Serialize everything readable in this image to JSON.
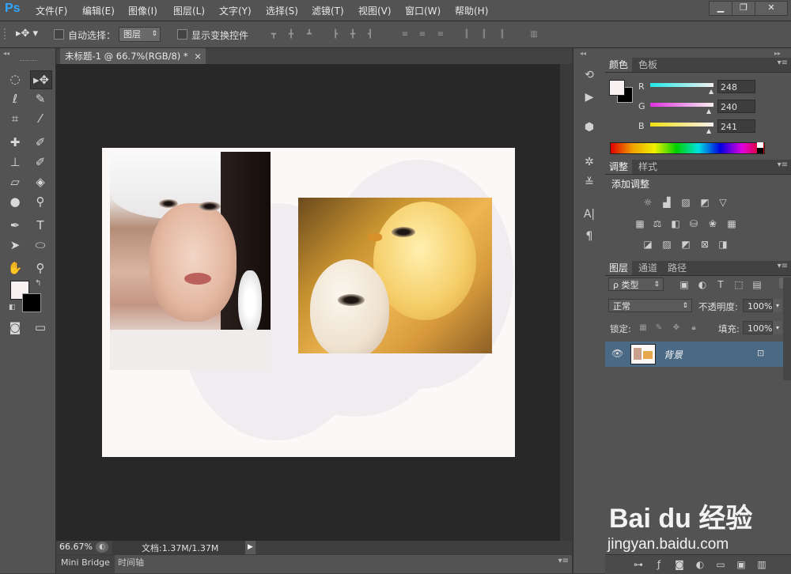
{
  "app": {
    "logo": "Ps"
  },
  "menu": [
    "文件(F)",
    "编辑(E)",
    "图像(I)",
    "图层(L)",
    "文字(Y)",
    "选择(S)",
    "滤镜(T)",
    "视图(V)",
    "窗口(W)",
    "帮助(H)"
  ],
  "window_controls": {
    "minimize": "▁",
    "restore": "❐",
    "close": "✕"
  },
  "options": {
    "auto_select_label": "自动选择：",
    "auto_select_value": "图层",
    "show_transform_label": "显示变换控件"
  },
  "document": {
    "tab_title": "未标题-1 @ 66.7%(RGB/8) *",
    "close": "×"
  },
  "status": {
    "zoom": "66.67%",
    "doc_info": "文档:1.37M/1.37M"
  },
  "bottom_tabs": [
    "Mini Bridge",
    "时间轴"
  ],
  "color_panel": {
    "tabs": [
      "颜色",
      "色板"
    ],
    "channels": [
      {
        "label": "R",
        "value": "248",
        "color": "#26e0e8"
      },
      {
        "label": "G",
        "value": "240",
        "color": "#e040d8"
      },
      {
        "label": "B",
        "value": "241",
        "color": "#f0e020"
      }
    ],
    "foreground": "#f8f0f1",
    "background": "#000000"
  },
  "adjust_panel": {
    "tabs": [
      "调整",
      "样式"
    ],
    "heading": "添加调整"
  },
  "layers_panel": {
    "tabs": [
      "图层",
      "通道",
      "路径"
    ],
    "filter_kind": "ρ 类型",
    "blend_mode": "正常",
    "opacity_label": "不透明度:",
    "opacity_value": "100%",
    "lock_label": "锁定:",
    "fill_label": "填充:",
    "fill_value": "100%",
    "layers": [
      {
        "name": "背景",
        "locked": true,
        "visible": true
      }
    ]
  },
  "watermark": {
    "logo": "Bai du 经验",
    "url": "jingyan.baidu.com"
  }
}
